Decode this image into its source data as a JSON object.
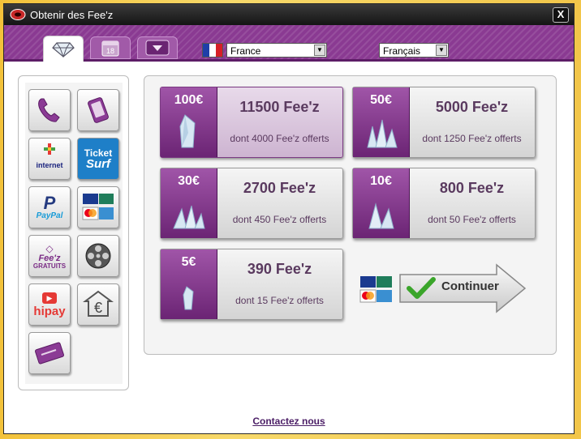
{
  "window": {
    "title": "Obtenir des Fee'z",
    "close_label": "X"
  },
  "tabs": [
    {
      "name": "diamond-tab",
      "icon": "diamond-icon",
      "active": true
    },
    {
      "name": "calendar-tab",
      "icon": "calendar-icon",
      "label": "18",
      "active": false
    },
    {
      "name": "gem-tab",
      "icon": "gem-icon",
      "active": false
    }
  ],
  "country": {
    "selected": "France",
    "flag_icon": "flag-france-icon"
  },
  "language": {
    "selected": "Français"
  },
  "payment_methods": [
    {
      "name": "phone",
      "icon": "phone-icon"
    },
    {
      "name": "mobile",
      "icon": "mobile-icon"
    },
    {
      "name": "internet-plus",
      "icon": "internet-plus-icon",
      "label": "internet"
    },
    {
      "name": "ticket-surf",
      "icon": "ticket-surf-icon",
      "label1": "Ticket",
      "label2": "Surf"
    },
    {
      "name": "paypal",
      "icon": "paypal-icon",
      "label": "PayPal"
    },
    {
      "name": "credit-cards",
      "icon": "credit-cards-icon"
    },
    {
      "name": "feez-gratuits",
      "icon": "feez-gratuits-icon",
      "label1": "Fee'z",
      "label2": "GRATUITS"
    },
    {
      "name": "video",
      "icon": "film-reel-icon"
    },
    {
      "name": "hipay",
      "icon": "hipay-icon",
      "label": "hipay"
    },
    {
      "name": "euro-transfer",
      "icon": "euro-transfer-icon"
    },
    {
      "name": "check",
      "icon": "cheque-icon"
    }
  ],
  "offers": [
    {
      "price": "100€",
      "amount": "11500 Fee'z",
      "bonus": "dont 4000 Fee'z offerts",
      "selected": true
    },
    {
      "price": "50€",
      "amount": "5000 Fee'z",
      "bonus": "dont 1250 Fee'z offerts",
      "selected": false
    },
    {
      "price": "30€",
      "amount": "2700 Fee'z",
      "bonus": "dont 450 Fee'z offerts",
      "selected": false
    },
    {
      "price": "10€",
      "amount": "800 Fee'z",
      "bonus": "dont 50 Fee'z offerts",
      "selected": false
    },
    {
      "price": "5€",
      "amount": "390 Fee'z",
      "bonus": "dont 15 Fee'z offerts",
      "selected": false
    }
  ],
  "continue": {
    "label": "Continuer",
    "icon": "checkmark-icon",
    "cards_icon": "card-logos-icon"
  },
  "footer": {
    "contact_label": "Contactez nous"
  },
  "colors": {
    "purple": "#8a3a92",
    "purple_dark": "#6b2474",
    "accent_green": "#3aa52a"
  }
}
